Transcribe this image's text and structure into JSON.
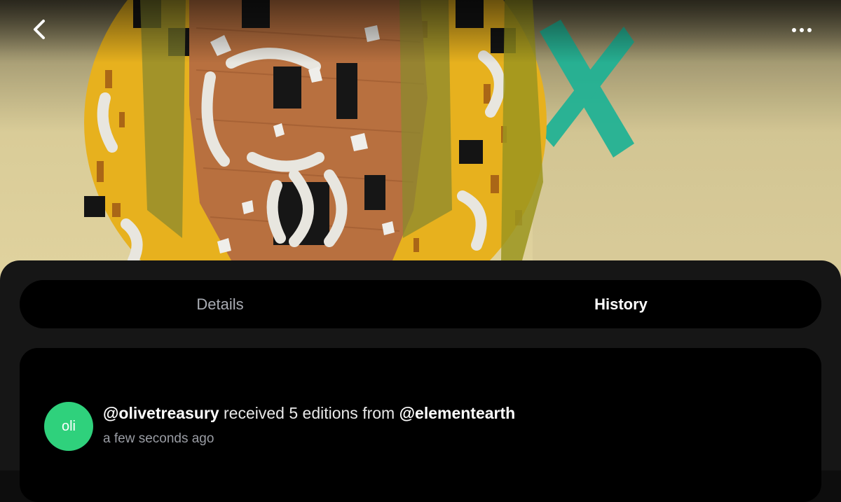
{
  "header": {
    "back_icon": "chevron-left-icon",
    "more_icon": "more-horizontal-icon"
  },
  "artwork": {
    "colors": {
      "wall": "#dccf9c",
      "mandala_gold": "#e7b11e",
      "wood": "#b8703f",
      "teal_x": "#1fb89a",
      "bars": "#8b8a2e"
    }
  },
  "tabs": [
    {
      "label": "Details",
      "active": false
    },
    {
      "label": "History",
      "active": true
    }
  ],
  "history": {
    "events": [
      {
        "avatar_initials": "oli",
        "avatar_color": "#2fd17c",
        "recipient": "@olivetreasury",
        "action": "received 5 editions from",
        "sender": "@elementearth",
        "time": "a few seconds ago"
      }
    ]
  }
}
